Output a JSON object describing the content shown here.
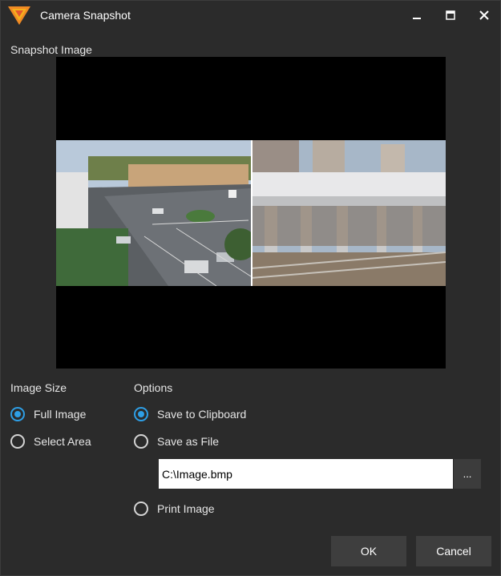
{
  "window": {
    "title": "Camera Snapshot",
    "logo_icon": "app-logo-icon",
    "accent_color": "#2e9fe6"
  },
  "snapshot": {
    "label": "Snapshot Image",
    "preview_icon": "camera-snapshot-image"
  },
  "image_size": {
    "label": "Image Size",
    "options": [
      {
        "label": "Full Image",
        "checked": true
      },
      {
        "label": "Select Area",
        "checked": false
      }
    ]
  },
  "options": {
    "label": "Options",
    "save_to_clipboard": {
      "label": "Save to Clipboard",
      "checked": true
    },
    "save_as_file": {
      "label": "Save as File",
      "checked": false
    },
    "file_path": "C:\\Image.bmp",
    "browse_label": "...",
    "print_image": {
      "label": "Print Image",
      "checked": false
    }
  },
  "buttons": {
    "ok": "OK",
    "cancel": "Cancel"
  }
}
